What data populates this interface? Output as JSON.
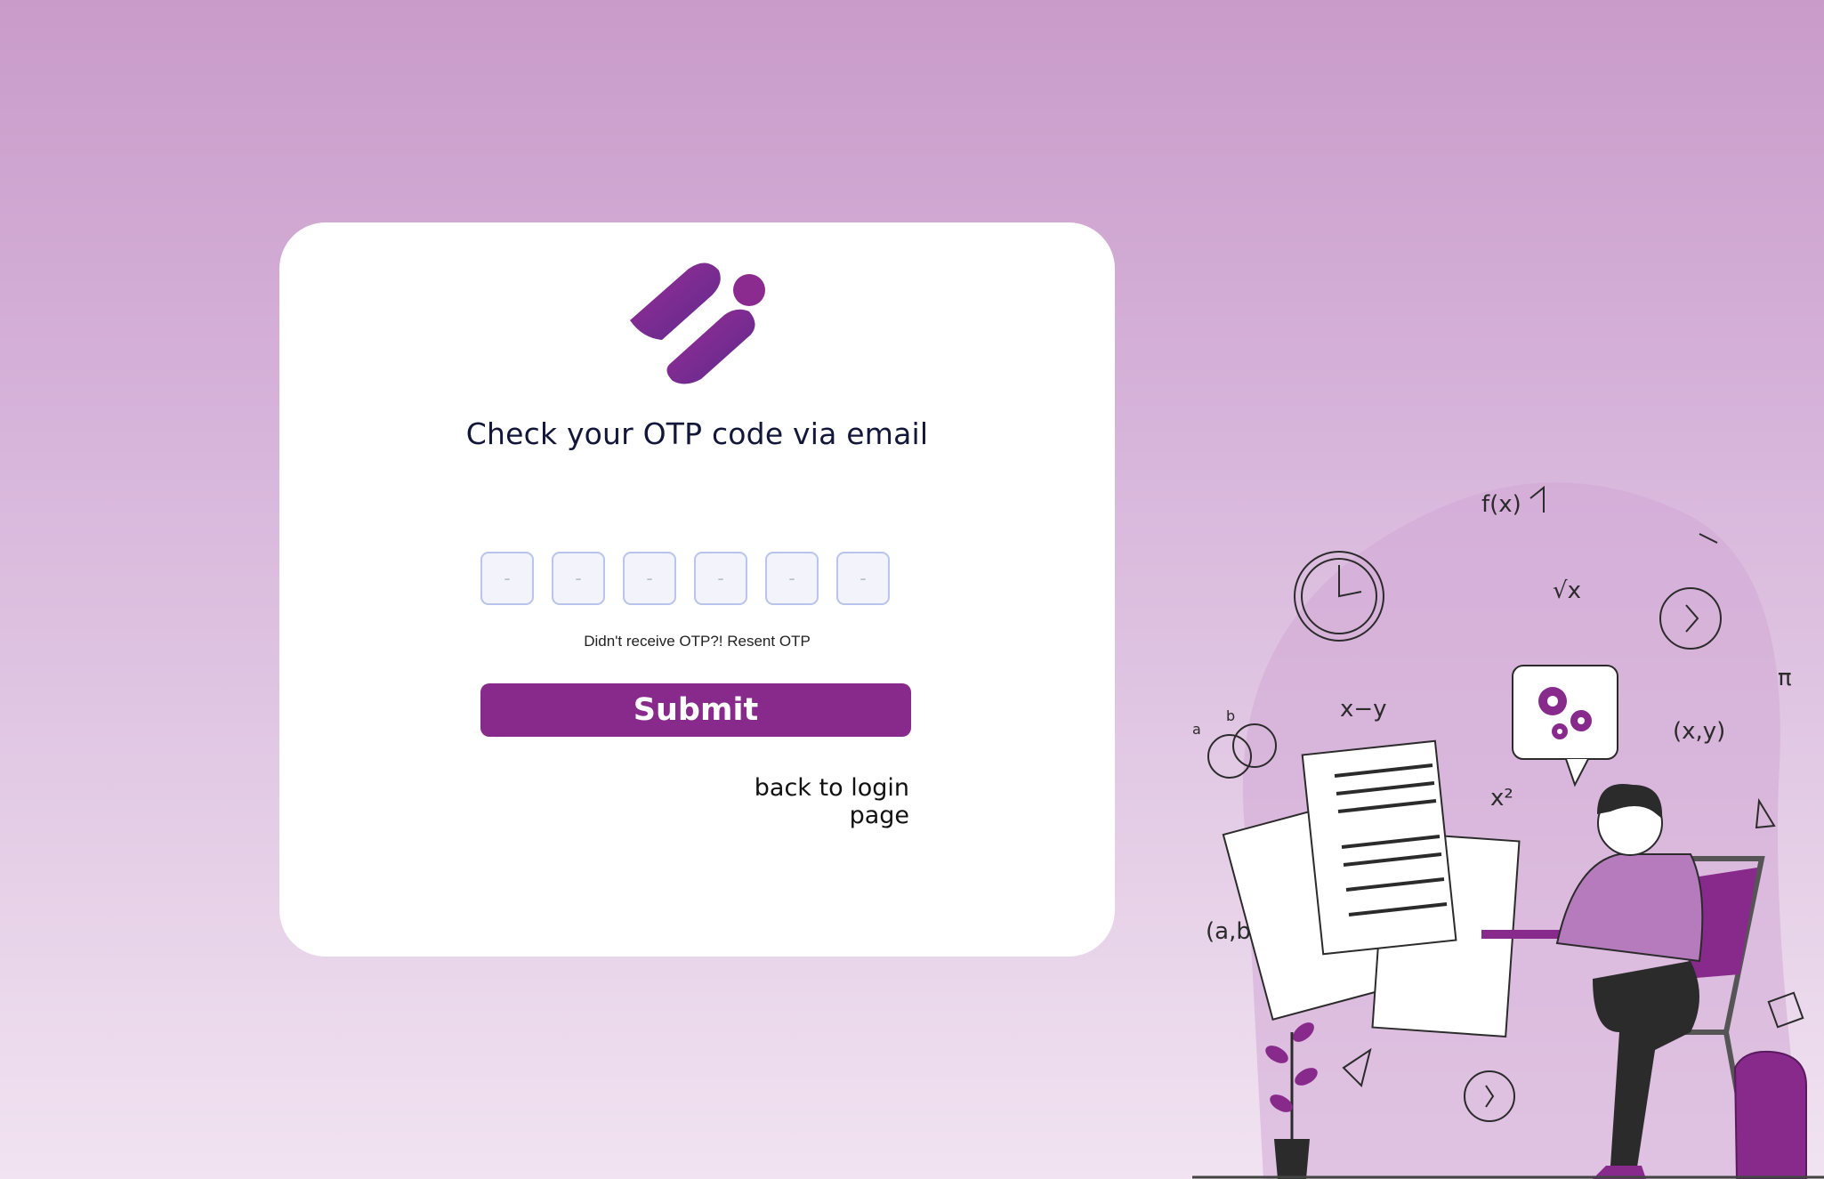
{
  "page": {
    "background_gradient": [
      "#c99bc9",
      "#f1e3f1"
    ]
  },
  "card": {
    "logo": {
      "icon": "brand-logo-icon",
      "colors": [
        "#922a94",
        "#5e2a8c"
      ]
    },
    "title": "Check your OTP code via email",
    "otp": {
      "placeholders": [
        "-",
        "-",
        "-",
        "-",
        "-",
        "-"
      ],
      "values": [
        "",
        "",
        "",
        "",
        "",
        ""
      ]
    },
    "resend": {
      "prompt": "Didn't receive OTP?!",
      "link": "Resent OTP"
    },
    "submit_label": "Submit",
    "back_link": "back to login page",
    "accent_color": "#882a8c"
  },
  "illustration": {
    "icon": "student-taking-exam-illustration",
    "labels": [
      "f(x)",
      "a",
      "b",
      "√x",
      "x−y",
      "(x,y)",
      "x²",
      "(a,b)",
      "π"
    ]
  }
}
